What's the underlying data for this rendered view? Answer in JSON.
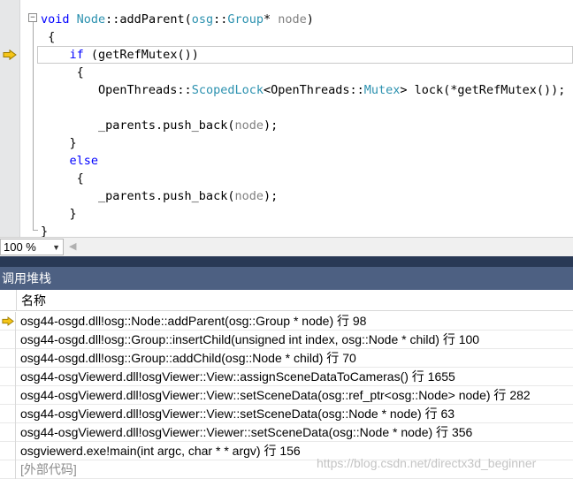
{
  "editor": {
    "lines": [
      {
        "parts": [
          {
            "t": "void",
            "c": "kw"
          },
          {
            "t": " "
          },
          {
            "t": "Node",
            "c": "ty"
          },
          {
            "t": "::addParent("
          },
          {
            "t": "osg",
            "c": "ty"
          },
          {
            "t": "::"
          },
          {
            "t": "Group",
            "c": "ty"
          },
          {
            "t": "* "
          },
          {
            "t": "node",
            "c": "pm"
          },
          {
            "t": ")"
          }
        ]
      },
      {
        "parts": [
          {
            "t": " {"
          }
        ]
      },
      {
        "parts": [
          {
            "t": "    "
          },
          {
            "t": "if",
            "c": "kw"
          },
          {
            "t": " (getRefMutex())"
          }
        ]
      },
      {
        "parts": [
          {
            "t": "     {"
          }
        ]
      },
      {
        "parts": [
          {
            "t": "        OpenThreads::"
          },
          {
            "t": "ScopedLock",
            "c": "ty"
          },
          {
            "t": "<OpenThreads::"
          },
          {
            "t": "Mutex",
            "c": "ty"
          },
          {
            "t": "> lock(*getRefMutex());"
          }
        ]
      },
      {
        "parts": [
          {
            "t": ""
          }
        ]
      },
      {
        "parts": [
          {
            "t": "        _parents.push_back("
          },
          {
            "t": "node",
            "c": "pm"
          },
          {
            "t": ");"
          }
        ]
      },
      {
        "parts": [
          {
            "t": "    }"
          }
        ]
      },
      {
        "parts": [
          {
            "t": "    "
          },
          {
            "t": "else",
            "c": "kw"
          }
        ]
      },
      {
        "parts": [
          {
            "t": "     {"
          }
        ]
      },
      {
        "parts": [
          {
            "t": "        _parents.push_back("
          },
          {
            "t": "node",
            "c": "pm"
          },
          {
            "t": ");"
          }
        ]
      },
      {
        "parts": [
          {
            "t": "    }"
          }
        ]
      },
      {
        "parts": [
          {
            "t": "}"
          }
        ]
      }
    ],
    "collapse_glyph": "−"
  },
  "zoom": {
    "value": "100 %"
  },
  "call_stack": {
    "title": "调用堆栈",
    "column_name": "名称",
    "rows": [
      {
        "text": "osg44-osgd.dll!osg::Node::addParent(osg::Group * node) 行 98",
        "current": true
      },
      {
        "text": "osg44-osgd.dll!osg::Group::insertChild(unsigned int index, osg::Node * child) 行 100"
      },
      {
        "text": "osg44-osgd.dll!osg::Group::addChild(osg::Node * child) 行 70"
      },
      {
        "text": "osg44-osgViewerd.dll!osgViewer::View::assignSceneDataToCameras() 行 1655"
      },
      {
        "text": "osg44-osgViewerd.dll!osgViewer::View::setSceneData(osg::ref_ptr<osg::Node> node) 行 282"
      },
      {
        "text": "osg44-osgViewerd.dll!osgViewer::View::setSceneData(osg::Node * node) 行 63"
      },
      {
        "text": "osg44-osgViewerd.dll!osgViewer::Viewer::setSceneData(osg::Node * node) 行 356"
      },
      {
        "text": "osgviewerd.exe!main(int argc, char * * argv) 行 156"
      },
      {
        "text": "[外部代码]",
        "external": true
      }
    ]
  },
  "watermark": "https://blog.csdn.net/directx3d_beginner",
  "colors": {
    "keyword": "#0000ff",
    "type": "#2b91af",
    "param": "#808080",
    "panel_title_bg": "#4d6082",
    "arrow": "#f5c518"
  }
}
